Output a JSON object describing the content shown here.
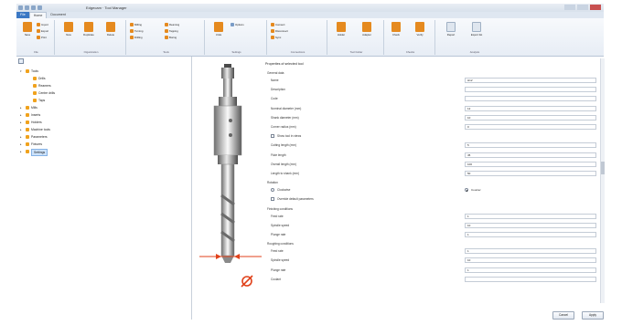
{
  "app": {
    "title": "Edgecam · Tool Manager"
  },
  "tabs": [
    "File",
    "Home",
    "Document"
  ],
  "ribbon": {
    "groups": [
      {
        "name": "File",
        "buttons": [
          "Save",
          "Import",
          "Export",
          "Print"
        ]
      },
      {
        "name": "Organization",
        "buttons": [
          "New",
          "Duplicate",
          "Delete"
        ]
      },
      {
        "name": "Tools",
        "buttons": [
          "Milling",
          "Turning",
          "Drilling",
          "Reaming",
          "Tapping",
          "Boring"
        ]
      },
      {
        "name": "Settings",
        "buttons": [
          "Units",
          "Options"
        ]
      },
      {
        "name": "Connections",
        "buttons": [
          "Connect",
          "Disconnect",
          "Sync"
        ]
      },
      {
        "name": "Tool holder",
        "buttons": [
          "Holder",
          "Adapter"
        ]
      },
      {
        "name": "Checks",
        "buttons": [
          "Check",
          "Verify"
        ]
      },
      {
        "name": "Analysis",
        "buttons": [
          "Report",
          "Export list"
        ]
      }
    ]
  },
  "tree": [
    {
      "label": "Tools",
      "depth": 0,
      "expanded": true,
      "selected": false
    },
    {
      "label": "Drills",
      "depth": 1,
      "expanded": false,
      "selected": false
    },
    {
      "label": "Reamers",
      "depth": 1,
      "expanded": false,
      "selected": false
    },
    {
      "label": "Centre drills",
      "depth": 1,
      "expanded": false,
      "selected": false
    },
    {
      "label": "Taps",
      "depth": 1,
      "expanded": false,
      "selected": false
    },
    {
      "label": "Mills",
      "depth": 0,
      "expanded": false,
      "selected": false
    },
    {
      "label": "Inserts",
      "depth": 0,
      "expanded": false,
      "selected": false
    },
    {
      "label": "Holders",
      "depth": 0,
      "expanded": false,
      "selected": false
    },
    {
      "label": "Machine tools",
      "depth": 0,
      "expanded": false,
      "selected": false
    },
    {
      "label": "Parameters",
      "depth": 0,
      "expanded": false,
      "selected": false
    },
    {
      "label": "Fixtures",
      "depth": 0,
      "expanded": false,
      "selected": false
    },
    {
      "label": "Settings",
      "depth": 0,
      "expanded": false,
      "selected": true
    }
  ],
  "properties": {
    "title": "Properties of selected tool",
    "rows": [
      {
        "kind": "section",
        "label": "General data"
      },
      {
        "kind": "field",
        "label": "Name",
        "value": "H12"
      },
      {
        "kind": "field",
        "label": "Description",
        "value": ""
      },
      {
        "kind": "field",
        "label": "Code",
        "value": ""
      },
      {
        "kind": "field",
        "label": "Nominal diameter (mm)",
        "value": "12"
      },
      {
        "kind": "field",
        "label": "Shank diameter (mm)",
        "value": "10"
      },
      {
        "kind": "field",
        "label": "Corner radius (mm)",
        "value": "0"
      },
      {
        "kind": "check",
        "label": "Show tool in views"
      },
      {
        "kind": "field",
        "label": "Cutting length (mm)",
        "value": "5"
      },
      {
        "kind": "field",
        "label": "Flute length",
        "value": "45"
      },
      {
        "kind": "field",
        "label": "Overall length (mm)",
        "value": "100"
      },
      {
        "kind": "field",
        "label": "Length to shank (mm)",
        "value": "50"
      },
      {
        "kind": "section",
        "label": "Rotation"
      },
      {
        "kind": "radio",
        "label": "Clockwise",
        "value": "Counter",
        "on": false
      },
      {
        "kind": "check",
        "label": "Override default parameters"
      },
      {
        "kind": "section",
        "label": "Finishing conditions"
      },
      {
        "kind": "field",
        "label": "Feed rate",
        "value": "1"
      },
      {
        "kind": "field",
        "label": "Spindle speed",
        "value": "10"
      },
      {
        "kind": "field",
        "label": "Plunge rate",
        "value": "1"
      },
      {
        "kind": "section",
        "label": "Roughing conditions"
      },
      {
        "kind": "field",
        "label": "Feed rate",
        "value": "1"
      },
      {
        "kind": "field",
        "label": "Spindle speed",
        "value": "10"
      },
      {
        "kind": "field",
        "label": "Plunge rate",
        "value": "1"
      },
      {
        "kind": "field",
        "label": "Coolant",
        "value": ""
      }
    ]
  },
  "buttons": {
    "cancel": "Cancel",
    "apply": "Apply"
  },
  "colors": {
    "accent": "#3b78c4",
    "icon": "#f0a21d",
    "dimension": "#e0421b"
  }
}
